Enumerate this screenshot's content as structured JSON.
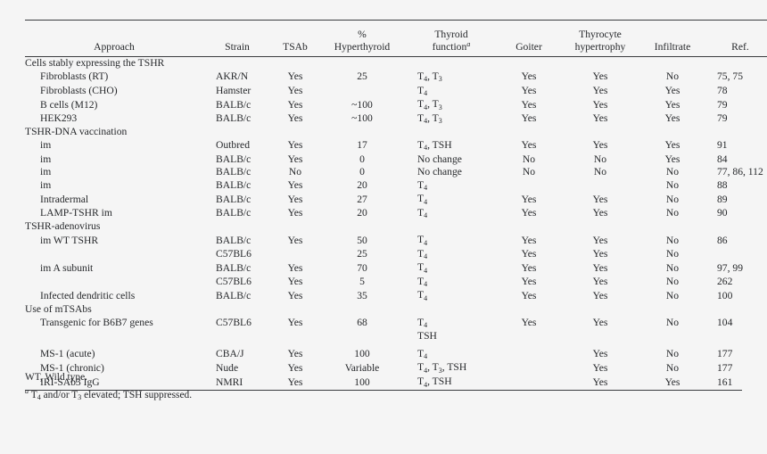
{
  "table": {
    "columns": [
      {
        "id": "approach",
        "label": "Approach"
      },
      {
        "id": "strain",
        "label": "Strain"
      },
      {
        "id": "tsab",
        "label": "TSAb"
      },
      {
        "id": "pct_line1",
        "label": "%"
      },
      {
        "id": "pct_line2",
        "label": "Hyperthyroid"
      },
      {
        "id": "func_line1",
        "label": "Thyroid"
      },
      {
        "id": "func_line2",
        "label": "function"
      },
      {
        "id": "goiter",
        "label": "Goiter"
      },
      {
        "id": "hyper_line1",
        "label": "Thyrocyte"
      },
      {
        "id": "hyper_line2",
        "label": "hypertrophy"
      },
      {
        "id": "infiltrate",
        "label": "Infiltrate"
      },
      {
        "id": "ref",
        "label": "Ref."
      }
    ],
    "header": {
      "approach": "Approach",
      "strain": "Strain",
      "tsab": "TSAb",
      "pct_line1": "%",
      "pct_line2": "Hyperthyroid",
      "func_line1": "Thyroid",
      "func_line2": "function",
      "func_marker": "a",
      "goiter": "Goiter",
      "hyper_line1": "Thyrocyte",
      "hyper_line2": "hypertrophy",
      "infiltrate": "Infiltrate",
      "ref": "Ref."
    },
    "groups": [
      {
        "title": "Cells stably expressing the TSHR",
        "rows": [
          {
            "approach": "Fibroblasts (RT)",
            "strain": "AKR/N",
            "tsab": "Yes",
            "pct": "25",
            "func": "T4, T3",
            "goiter": "Yes",
            "hypertrophy": "Yes",
            "infiltrate": "No",
            "ref": "75, 75"
          },
          {
            "approach": "Fibroblasts (CHO)",
            "strain": "Hamster",
            "tsab": "Yes",
            "pct": "",
            "func": "T4",
            "goiter": "Yes",
            "hypertrophy": "Yes",
            "infiltrate": "Yes",
            "ref": "78"
          },
          {
            "approach": "B cells (M12)",
            "strain": "BALB/c",
            "tsab": "Yes",
            "pct": "~100",
            "func": "T4, T3",
            "goiter": "Yes",
            "hypertrophy": "Yes",
            "infiltrate": "Yes",
            "ref": "79"
          },
          {
            "approach": "HEK293",
            "strain": "BALB/c",
            "tsab": "Yes",
            "pct": "~100",
            "func": "T4, T3",
            "goiter": "Yes",
            "hypertrophy": "Yes",
            "infiltrate": "Yes",
            "ref": "79"
          }
        ]
      },
      {
        "title": "TSHR-DNA vaccination",
        "rows": [
          {
            "approach": "im",
            "strain": "Outbred",
            "tsab": "Yes",
            "pct": "17",
            "func": "T4, TSH",
            "goiter": "Yes",
            "hypertrophy": "Yes",
            "infiltrate": "Yes",
            "ref": "91"
          },
          {
            "approach": "im",
            "strain": "BALB/c",
            "tsab": "Yes",
            "pct": "0",
            "func": "No change",
            "goiter": "No",
            "hypertrophy": "No",
            "infiltrate": "Yes",
            "ref": "84"
          },
          {
            "approach": "im",
            "strain": "BALB/c",
            "tsab": "No",
            "pct": "0",
            "func": "No change",
            "goiter": "No",
            "hypertrophy": "No",
            "infiltrate": "No",
            "ref": "77, 86, 112"
          },
          {
            "approach": "im",
            "strain": "BALB/c",
            "tsab": "Yes",
            "pct": "20",
            "func": "T4",
            "goiter": "",
            "hypertrophy": "",
            "infiltrate": "No",
            "ref": "88"
          },
          {
            "approach": "Intradermal",
            "strain": "BALB/c",
            "tsab": "Yes",
            "pct": "27",
            "func": "T4",
            "goiter": "Yes",
            "hypertrophy": "Yes",
            "infiltrate": "No",
            "ref": "89"
          },
          {
            "approach": "LAMP-TSHR im",
            "strain": "BALB/c",
            "tsab": "Yes",
            "pct": "20",
            "func": "T4",
            "goiter": "Yes",
            "hypertrophy": "Yes",
            "infiltrate": "No",
            "ref": "90"
          }
        ]
      },
      {
        "title": "TSHR-adenovirus",
        "rows": [
          {
            "approach": "im WT TSHR",
            "strain": "BALB/c",
            "tsab": "Yes",
            "pct": "50",
            "func": "T4",
            "goiter": "Yes",
            "hypertrophy": "Yes",
            "infiltrate": "No",
            "ref": "86"
          },
          {
            "approach": "",
            "strain": "C57BL6",
            "tsab": "",
            "pct": "25",
            "func": "T4",
            "goiter": "Yes",
            "hypertrophy": "Yes",
            "infiltrate": "No",
            "ref": ""
          },
          {
            "approach": "im A subunit",
            "strain": "BALB/c",
            "tsab": "Yes",
            "pct": "70",
            "func": "T4",
            "goiter": "Yes",
            "hypertrophy": "Yes",
            "infiltrate": "No",
            "ref": "97, 99"
          },
          {
            "approach": "",
            "strain": "C57BL6",
            "tsab": "Yes",
            "pct": "5",
            "func": "T4",
            "goiter": "Yes",
            "hypertrophy": "Yes",
            "infiltrate": "No",
            "ref": "262"
          },
          {
            "approach": "Infected dendritic cells",
            "strain": "BALB/c",
            "tsab": "Yes",
            "pct": "35",
            "func": "T4",
            "goiter": "Yes",
            "hypertrophy": "Yes",
            "infiltrate": "No",
            "ref": "100"
          }
        ]
      },
      {
        "title": "Use of mTSAbs",
        "rows": [
          {
            "approach": "Transgenic for B6B7 genes",
            "strain": "C57BL6",
            "tsab": "Yes",
            "pct": "68",
            "func": "T4",
            "func2": "TSH",
            "goiter": "Yes",
            "hypertrophy": "Yes",
            "infiltrate": "No",
            "ref": "104"
          },
          {
            "approach": "MS-1 (acute)",
            "strain": "CBA/J",
            "tsab": "Yes",
            "pct": "100",
            "func": "T4",
            "goiter": "",
            "hypertrophy": "Yes",
            "infiltrate": "No",
            "ref": "177",
            "pad_top": true
          },
          {
            "approach": "MS-1 (chronic)",
            "strain": "Nude",
            "tsab": "Yes",
            "pct": "Variable",
            "func": "T4, T3, TSH",
            "goiter": "",
            "hypertrophy": "Yes",
            "infiltrate": "No",
            "ref": "177"
          },
          {
            "approach": "IRI-SAb3 IgG",
            "strain": "NMRI",
            "tsab": "Yes",
            "pct": "100",
            "func": "T4, TSH",
            "goiter": "",
            "hypertrophy": "Yes",
            "infiltrate": "Yes",
            "ref": "161"
          }
        ]
      }
    ]
  },
  "footnotes": {
    "line1": "WT, Wild type.",
    "line2_marker": "a",
    "line2": "T4 and/or T3 elevated; TSH suppressed."
  },
  "colors": {
    "background": "#f5f5f5",
    "text": "#26282b",
    "rule": "#3a3c3f"
  }
}
